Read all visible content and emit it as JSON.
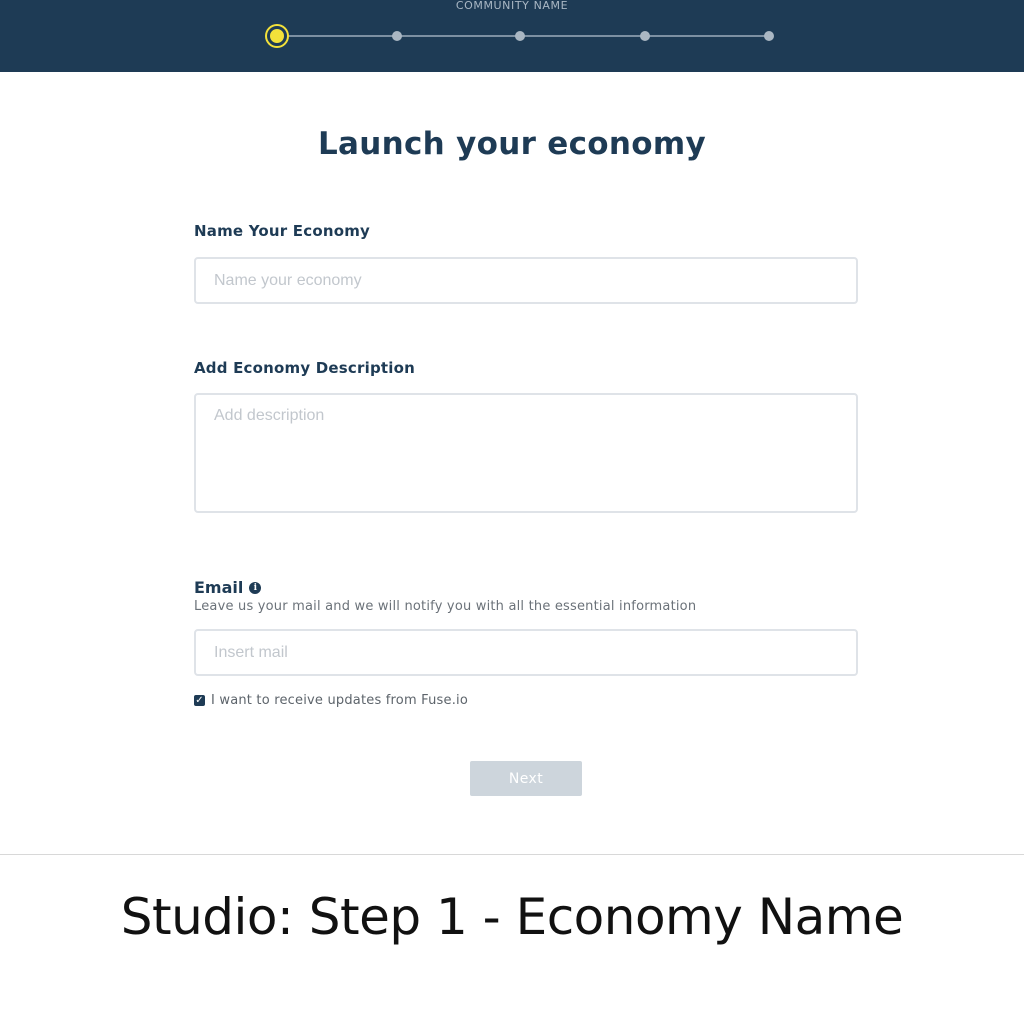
{
  "header": {
    "step_caption": "COMMUNITY NAME",
    "steps_total": 5,
    "active_step": 1
  },
  "form": {
    "title": "Launch your economy",
    "name_label": "Name Your Economy",
    "name_placeholder": "Name your economy",
    "description_label": "Add Economy Description",
    "description_placeholder": "Add description",
    "email_label": "Email",
    "email_helper": "Leave us your mail and we will notify you with all the essential information",
    "email_placeholder": "Insert mail",
    "updates_checkbox_label": "I want to receive updates from Fuse.io",
    "updates_checked": true,
    "next_label": "Next"
  },
  "caption": "Studio: Step 1 - Economy Name",
  "colors": {
    "header_bg": "#1e3b55",
    "accent": "#f3e13a",
    "disabled_button": "#cdd5dc"
  }
}
